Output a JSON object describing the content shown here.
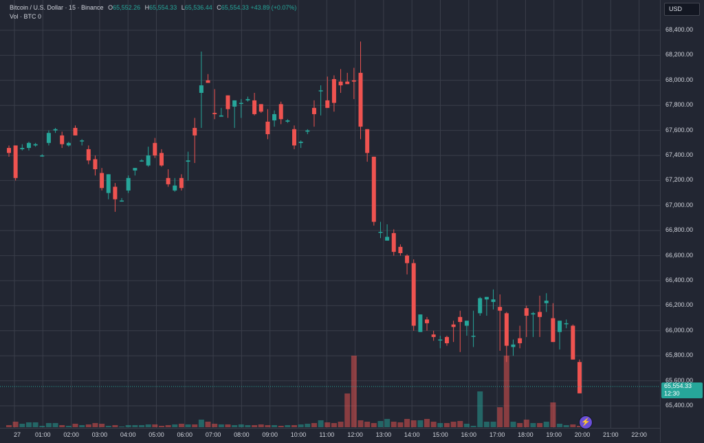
{
  "legend": {
    "symbol": "Bitcoin / U.S. Dollar · 15 · Binance",
    "o_label": "O",
    "o": "65,552.26",
    "h_label": "H",
    "h": "65,554.33",
    "l_label": "L",
    "l": "65,536.44",
    "c_label": "C",
    "c": "65,554.33",
    "change": "+43.89 (+0.07%)",
    "vol_label": "Vol · BTC",
    "vol_value": "0"
  },
  "currency": "USD",
  "last_price": {
    "value": "65,554.33",
    "countdown": "12:30"
  },
  "colors": {
    "up": "#26a69a",
    "down": "#ef5350",
    "bg": "#222632",
    "grid": "#3a3e4a"
  },
  "logo_icon": "lightning-bolt-icon",
  "chart_data": {
    "type": "candlestick",
    "price_ticks": [
      "68,400.00",
      "68,200.00",
      "68,000.00",
      "67,800.00",
      "67,600.00",
      "67,400.00",
      "67,200.00",
      "67,000.00",
      "66,800.00",
      "66,600.00",
      "66,400.00",
      "66,200.00",
      "66,000.00",
      "65,800.00",
      "65,600.00",
      "65,400.00"
    ],
    "time_ticks": [
      "27",
      "01:00",
      "02:00",
      "03:00",
      "04:00",
      "05:00",
      "06:00",
      "07:00",
      "08:00",
      "09:00",
      "10:00",
      "11:00",
      "12:00",
      "13:00",
      "14:00",
      "15:00",
      "16:00",
      "17:00",
      "18:00",
      "19:00",
      "20:00",
      "21:00",
      "22:00"
    ],
    "ylim": [
      65330,
      68480
    ],
    "grid": true,
    "candles": [
      [
        67460,
        67480,
        67390,
        67420
      ],
      [
        67480,
        67480,
        67200,
        67220
      ],
      [
        67450,
        67490,
        67440,
        67460
      ],
      [
        67460,
        67510,
        67440,
        67500
      ],
      [
        67480,
        67500,
        67470,
        67490
      ],
      [
        67400,
        67410,
        67390,
        67400
      ],
      [
        67500,
        67600,
        67480,
        67580
      ],
      [
        67600,
        67620,
        67580,
        67610
      ],
      [
        67560,
        67590,
        67460,
        67490
      ],
      [
        67480,
        67510,
        67470,
        67500
      ],
      [
        67620,
        67640,
        67560,
        67560
      ],
      [
        67520,
        67530,
        67480,
        67520
      ],
      [
        67450,
        67480,
        67330,
        67360
      ],
      [
        67370,
        67400,
        67240,
        67290
      ],
      [
        67260,
        67300,
        67120,
        67140
      ],
      [
        67100,
        67250,
        67050,
        67250
      ],
      [
        67150,
        67180,
        66950,
        67050
      ],
      [
        67040,
        67060,
        67030,
        67040
      ],
      [
        67120,
        67240,
        67100,
        67220
      ],
      [
        67280,
        67300,
        67240,
        67300
      ],
      [
        67360,
        67370,
        67350,
        67360
      ],
      [
        67320,
        67470,
        67310,
        67400
      ],
      [
        67500,
        67540,
        67380,
        67400
      ],
      [
        67420,
        67450,
        67310,
        67320
      ],
      [
        67220,
        67290,
        67150,
        67170
      ],
      [
        67120,
        67220,
        67110,
        67160
      ],
      [
        67220,
        67250,
        67120,
        67140
      ],
      [
        67350,
        67430,
        67200,
        67360
      ],
      [
        67620,
        67700,
        67340,
        67560
      ],
      [
        67900,
        68230,
        67620,
        67960
      ],
      [
        68000,
        68050,
        67980,
        67980
      ],
      [
        67740,
        67930,
        67690,
        67730
      ],
      [
        67710,
        67780,
        67720,
        67720
      ],
      [
        67880,
        67870,
        67700,
        67770
      ],
      [
        67790,
        67840,
        67620,
        67840
      ],
      [
        67820,
        67850,
        67700,
        67820
      ],
      [
        67840,
        67870,
        67830,
        67850
      ],
      [
        67840,
        67900,
        67720,
        67730
      ],
      [
        67810,
        67810,
        67740,
        67750
      ],
      [
        67670,
        67770,
        67530,
        67570
      ],
      [
        67680,
        67760,
        67630,
        67730
      ],
      [
        67810,
        67830,
        67650,
        67690
      ],
      [
        67670,
        67690,
        67660,
        67680
      ],
      [
        67610,
        67640,
        67450,
        67480
      ],
      [
        67500,
        67520,
        67460,
        67510
      ],
      [
        67590,
        67610,
        67570,
        67600
      ],
      [
        67780,
        67840,
        67630,
        67730
      ],
      [
        67920,
        67960,
        67720,
        67920
      ],
      [
        67840,
        68030,
        67810,
        67780
      ],
      [
        68010,
        68040,
        67750,
        67820
      ],
      [
        67990,
        68090,
        67900,
        67960
      ],
      [
        67990,
        68060,
        67980,
        67970
      ],
      [
        68000,
        68100,
        67850,
        67990
      ],
      [
        68060,
        68310,
        67530,
        67630
      ],
      [
        67610,
        67580,
        67350,
        67420
      ],
      [
        67390,
        67380,
        66840,
        66870
      ],
      [
        66790,
        66870,
        66740,
        66790
      ],
      [
        66720,
        66850,
        66760,
        66750
      ],
      [
        66780,
        66810,
        66600,
        66630
      ],
      [
        66670,
        66690,
        66600,
        66620
      ],
      [
        66600,
        66610,
        66450,
        66540
      ],
      [
        66540,
        66570,
        66000,
        66040
      ],
      [
        65990,
        66090,
        66080,
        66130
      ],
      [
        66090,
        66110,
        66000,
        66060
      ],
      [
        65970,
        66000,
        65920,
        65950
      ],
      [
        65930,
        65960,
        65860,
        65930
      ],
      [
        65950,
        65960,
        65880,
        65900
      ],
      [
        66050,
        66080,
        65910,
        66030
      ],
      [
        66110,
        66160,
        65830,
        66070
      ],
      [
        66040,
        66080,
        65960,
        66080
      ],
      [
        65960,
        66160,
        65870,
        65960
      ],
      [
        66140,
        66270,
        66120,
        66260
      ],
      [
        66250,
        66260,
        66120,
        66270
      ],
      [
        66230,
        66330,
        66170,
        66250
      ],
      [
        66190,
        66290,
        65840,
        66160
      ],
      [
        66140,
        66150,
        65750,
        65880
      ],
      [
        65870,
        65930,
        65800,
        65890
      ],
      [
        65940,
        66040,
        65860,
        65900
      ],
      [
        66180,
        66200,
        65950,
        66120
      ],
      [
        66130,
        66150,
        65950,
        66140
      ],
      [
        66150,
        66280,
        65950,
        66110
      ],
      [
        66220,
        66300,
        66150,
        66240
      ],
      [
        66100,
        66220,
        65940,
        65910
      ],
      [
        65990,
        66080,
        65850,
        66080
      ],
      [
        66060,
        66090,
        66020,
        66060
      ],
      [
        66040,
        66050,
        65800,
        65770
      ],
      [
        65750,
        65770,
        65500,
        65500
      ]
    ],
    "volumes": [
      [
        3,
        0
      ],
      [
        8,
        0
      ],
      [
        5,
        0
      ],
      [
        7,
        0
      ],
      [
        7,
        0
      ],
      [
        2,
        0
      ],
      [
        6,
        0
      ],
      [
        6,
        0
      ],
      [
        3,
        0
      ],
      [
        2,
        0
      ],
      [
        5,
        0
      ],
      [
        3,
        0
      ],
      [
        4,
        0
      ],
      [
        6,
        0
      ],
      [
        5,
        0
      ],
      [
        2,
        0
      ],
      [
        3,
        0
      ],
      [
        1,
        0
      ],
      [
        3,
        0
      ],
      [
        3,
        0
      ],
      [
        3,
        0
      ],
      [
        4,
        0
      ],
      [
        4,
        0
      ],
      [
        2,
        0
      ],
      [
        3,
        0
      ],
      [
        4,
        0
      ],
      [
        5,
        0
      ],
      [
        4,
        0
      ],
      [
        4,
        0
      ],
      [
        11,
        0
      ],
      [
        8,
        0
      ],
      [
        5,
        0
      ],
      [
        4,
        0
      ],
      [
        4,
        0
      ],
      [
        3,
        0
      ],
      [
        4,
        0
      ],
      [
        3,
        0
      ],
      [
        3,
        0
      ],
      [
        4,
        0
      ],
      [
        3,
        0
      ],
      [
        3,
        0
      ],
      [
        2,
        0
      ],
      [
        3,
        0
      ],
      [
        3,
        0
      ],
      [
        4,
        0
      ],
      [
        5,
        0
      ],
      [
        6,
        0
      ],
      [
        10,
        0
      ],
      [
        7,
        0
      ],
      [
        6,
        0
      ],
      [
        8,
        0
      ],
      [
        49,
        0
      ],
      [
        104,
        0
      ],
      [
        10,
        0
      ],
      [
        8,
        0
      ],
      [
        6,
        0
      ],
      [
        9,
        0
      ],
      [
        12,
        0
      ],
      [
        8,
        0
      ],
      [
        7,
        0
      ],
      [
        12,
        0
      ],
      [
        10,
        0
      ],
      [
        10,
        0
      ],
      [
        12,
        0
      ],
      [
        8,
        0
      ],
      [
        6,
        0
      ],
      [
        6,
        0
      ],
      [
        8,
        0
      ],
      [
        9,
        0
      ],
      [
        5,
        0
      ],
      [
        2,
        0
      ],
      [
        52,
        0
      ],
      [
        8,
        0
      ],
      [
        8,
        0
      ],
      [
        29,
        0
      ],
      [
        104,
        0
      ],
      [
        8,
        0
      ],
      [
        6,
        0
      ],
      [
        11,
        0
      ],
      [
        6,
        0
      ],
      [
        6,
        0
      ],
      [
        8,
        0
      ],
      [
        36,
        0
      ],
      [
        5,
        0
      ],
      [
        3,
        0
      ],
      [
        4,
        0
      ],
      [
        2,
        0
      ]
    ]
  }
}
